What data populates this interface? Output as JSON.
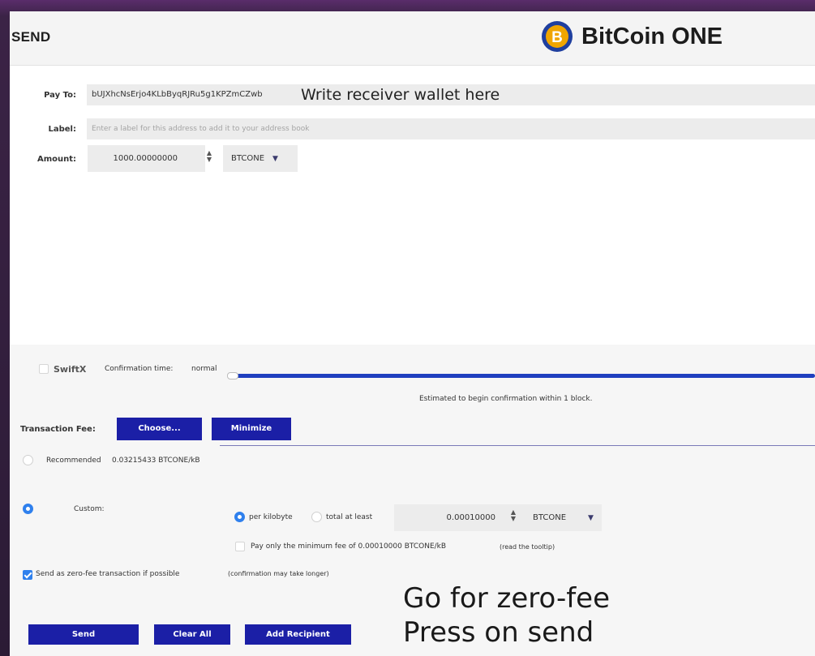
{
  "header": {
    "title": "SEND",
    "brand_name": "BitCoin ONE",
    "brand_logo_letter": "B",
    "brand_color": "#1f3f9f",
    "brand_accent": "#f0a500"
  },
  "pay_to": {
    "label": "Pay To:",
    "value": "bUJXhcNsErjo4KLbByqRJRu5g1KPZmCZwb",
    "hint": "Write receiver wallet here"
  },
  "label_field": {
    "label": "Label:",
    "placeholder": "Enter a label for this address to add it to your address book"
  },
  "amount": {
    "label": "Amount:",
    "value": "1000.00000000",
    "unit": "BTCONE"
  },
  "confirmation": {
    "swiftx_label": "SwiftX",
    "swiftx_checked": false,
    "time_label": "Confirmation time:",
    "time_value": "normal",
    "estimate": "Estimated to begin confirmation within 1 block."
  },
  "transaction_fee": {
    "label": "Transaction Fee:",
    "choose_label": "Choose...",
    "minimize_label": "Minimize",
    "recommended_label": "Recommended",
    "recommended_value": "0.03215433 BTCONE/kB",
    "custom_label": "Custom:",
    "per_kilobyte_label": "per kilobyte",
    "total_at_least_label": "total at least",
    "custom_value": "0.00010000",
    "custom_unit": "BTCONE",
    "min_fee_label": "Pay only the minimum fee of 0.00010000 BTCONE/kB",
    "min_fee_note": "(read the tooltip)",
    "zero_fee_label": "Send as zero-fee transaction if possible",
    "zero_fee_note": "(confirmation may take longer)"
  },
  "actions": {
    "send_label": "Send",
    "clear_label": "Clear All",
    "add_recipient_label": "Add Recipient"
  },
  "annotation": {
    "line1": "Go for zero-fee",
    "line2": "Press on send"
  },
  "colors": {
    "primary_button": "#1b1fa6",
    "slider": "#1f3fbf",
    "check_blue": "#2f80ed",
    "field_bg": "#ececec"
  }
}
